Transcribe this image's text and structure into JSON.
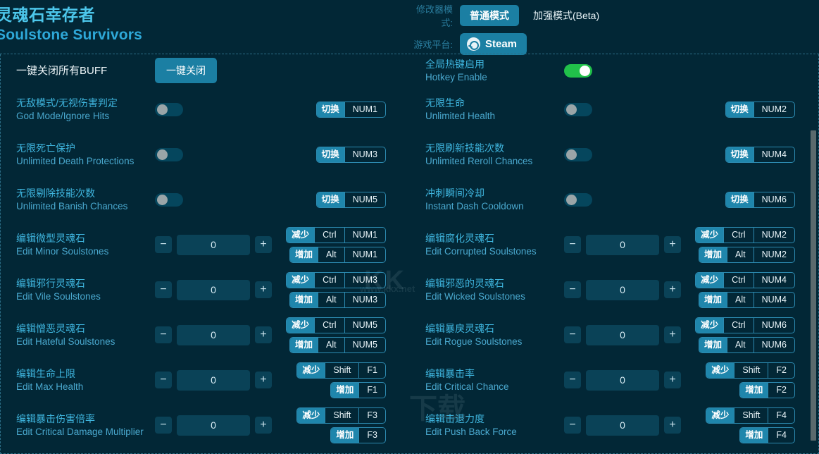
{
  "header": {
    "title_cn": "灵魂石幸存者",
    "title_en": "Soulstone Survivors",
    "mode_label": "修改器模式:",
    "mode_active": "普通模式",
    "mode_alt": "加强模式(Beta)",
    "platform_label": "游戏平台:",
    "platform_value": "Steam",
    "steam_icon": "steam-icon"
  },
  "top": {
    "allbuff_label": "一键关闭所有BUFF",
    "allbuff_button": "一键关闭",
    "hotkey_cn": "全局热键启用",
    "hotkey_en": "Hotkey Enable",
    "hotkey_state": "on"
  },
  "watermark": {
    "w1": "www.kkx.net",
    "w2": "KK",
    "w3": "下载"
  },
  "left_column": [
    {
      "kind": "toggle",
      "cn": "无敌模式/无视伤害判定",
      "en": "God Mode/Ignore Hits",
      "state": "off",
      "hotkeys": [
        {
          "action": "切换",
          "keys": [
            "NUM1"
          ]
        }
      ]
    },
    {
      "kind": "toggle",
      "cn": "无限死亡保护",
      "en": "Unlimited Death Protections",
      "state": "off",
      "hotkeys": [
        {
          "action": "切换",
          "keys": [
            "NUM3"
          ]
        }
      ]
    },
    {
      "kind": "toggle",
      "cn": "无限剔除技能次数",
      "en": "Unlimited Banish Chances",
      "state": "off",
      "hotkeys": [
        {
          "action": "切换",
          "keys": [
            "NUM5"
          ]
        }
      ]
    },
    {
      "kind": "stepper",
      "cn": "编辑微型灵魂石",
      "en": "Edit Minor Soulstones",
      "value": "0",
      "minus": "−",
      "plus": "+",
      "hotkeys": [
        {
          "action": "减少",
          "keys": [
            "Ctrl",
            "NUM1"
          ]
        },
        {
          "action": "增加",
          "keys": [
            "Alt",
            "NUM1"
          ]
        }
      ]
    },
    {
      "kind": "stepper",
      "cn": "编辑邪行灵魂石",
      "en": "Edit Vile Soulstones",
      "value": "0",
      "minus": "−",
      "plus": "+",
      "hotkeys": [
        {
          "action": "减少",
          "keys": [
            "Ctrl",
            "NUM3"
          ]
        },
        {
          "action": "增加",
          "keys": [
            "Alt",
            "NUM3"
          ]
        }
      ]
    },
    {
      "kind": "stepper",
      "cn": "编辑憎恶灵魂石",
      "en": "Edit Hateful Soulstones",
      "value": "0",
      "minus": "−",
      "plus": "+",
      "hotkeys": [
        {
          "action": "减少",
          "keys": [
            "Ctrl",
            "NUM5"
          ]
        },
        {
          "action": "增加",
          "keys": [
            "Alt",
            "NUM5"
          ]
        }
      ]
    },
    {
      "kind": "stepper",
      "cn": "编辑生命上限",
      "en": "Edit Max Health",
      "value": "0",
      "minus": "−",
      "plus": "+",
      "hotkeys": [
        {
          "action": "减少",
          "keys": [
            "Shift",
            "F1"
          ]
        },
        {
          "action": "增加",
          "keys": [
            "F1"
          ]
        }
      ]
    },
    {
      "kind": "stepper",
      "cn": "编辑暴击伤害倍率",
      "en": "Edit Critical Damage Multiplier",
      "value": "0",
      "minus": "−",
      "plus": "+",
      "hotkeys": [
        {
          "action": "减少",
          "keys": [
            "Shift",
            "F3"
          ]
        },
        {
          "action": "增加",
          "keys": [
            "F3"
          ]
        }
      ]
    }
  ],
  "right_column": [
    {
      "kind": "toggle",
      "cn": "无限生命",
      "en": "Unlimited Health",
      "state": "off",
      "hotkeys": [
        {
          "action": "切换",
          "keys": [
            "NUM2"
          ]
        }
      ]
    },
    {
      "kind": "toggle",
      "cn": "无限刷新技能次数",
      "en": "Unlimited Reroll Chances",
      "state": "off",
      "hotkeys": [
        {
          "action": "切换",
          "keys": [
            "NUM4"
          ]
        }
      ]
    },
    {
      "kind": "toggle",
      "cn": "冲刺瞬间冷却",
      "en": "Instant Dash Cooldown",
      "state": "off",
      "hotkeys": [
        {
          "action": "切换",
          "keys": [
            "NUM6"
          ]
        }
      ]
    },
    {
      "kind": "stepper",
      "cn": "编辑腐化灵魂石",
      "en": "Edit Corrupted Soulstones",
      "value": "0",
      "minus": "−",
      "plus": "+",
      "hotkeys": [
        {
          "action": "减少",
          "keys": [
            "Ctrl",
            "NUM2"
          ]
        },
        {
          "action": "增加",
          "keys": [
            "Alt",
            "NUM2"
          ]
        }
      ]
    },
    {
      "kind": "stepper",
      "cn": "编辑邪恶的灵魂石",
      "en": "Edit Wicked Soulstones",
      "value": "0",
      "minus": "−",
      "plus": "+",
      "hotkeys": [
        {
          "action": "减少",
          "keys": [
            "Ctrl",
            "NUM4"
          ]
        },
        {
          "action": "增加",
          "keys": [
            "Alt",
            "NUM4"
          ]
        }
      ]
    },
    {
      "kind": "stepper",
      "cn": "编辑暴戾灵魂石",
      "en": "Edit Rogue Soulstones",
      "value": "0",
      "minus": "−",
      "plus": "+",
      "hotkeys": [
        {
          "action": "减少",
          "keys": [
            "Ctrl",
            "NUM6"
          ]
        },
        {
          "action": "增加",
          "keys": [
            "Alt",
            "NUM6"
          ]
        }
      ]
    },
    {
      "kind": "stepper",
      "cn": "编辑暴击率",
      "en": "Edit Critical Chance",
      "value": "0",
      "minus": "−",
      "plus": "+",
      "hotkeys": [
        {
          "action": "减少",
          "keys": [
            "Shift",
            "F2"
          ]
        },
        {
          "action": "增加",
          "keys": [
            "F2"
          ]
        }
      ]
    },
    {
      "kind": "stepper",
      "cn": "编辑击退力度",
      "en": "Edit Push Back Force",
      "value": "0",
      "minus": "−",
      "plus": "+",
      "hotkeys": [
        {
          "action": "减少",
          "keys": [
            "Shift",
            "F4"
          ]
        },
        {
          "action": "增加",
          "keys": [
            "F4"
          ]
        }
      ]
    }
  ],
  "colors": {
    "background": "#022736",
    "accent": "#1b7fa3",
    "label_cn": "#3fb6df",
    "label_en": "#4aa9cf",
    "toggle_on": "#21c14a",
    "field": "#0a4257"
  }
}
